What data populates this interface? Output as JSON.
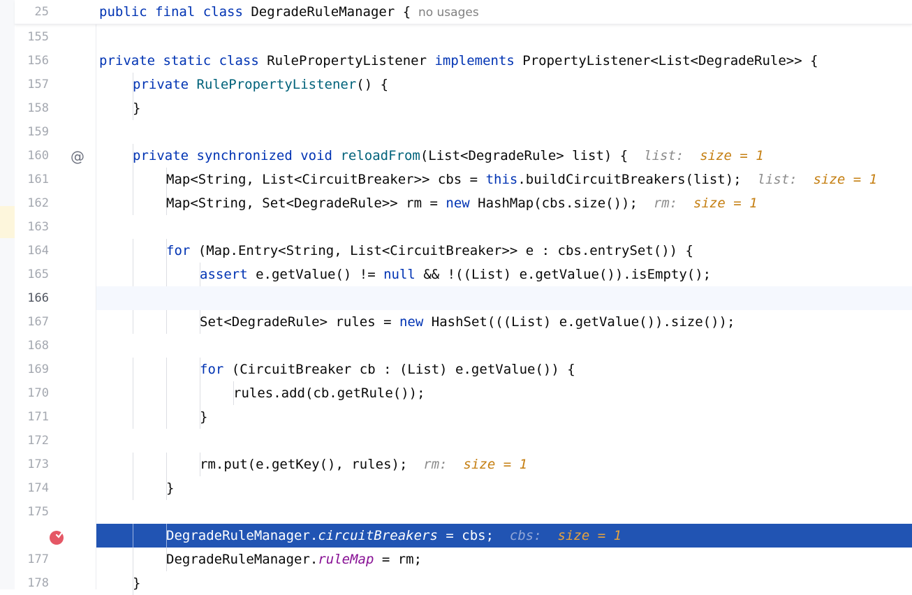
{
  "editor": {
    "sticky_line": {
      "number": "25",
      "tokens": [
        {
          "t": "public ",
          "c": "kw"
        },
        {
          "t": "final ",
          "c": "kw"
        },
        {
          "t": "class ",
          "c": "kw"
        },
        {
          "t": "DegradeRuleManager {"
        }
      ],
      "usages_label": "no usages"
    },
    "lines": [
      {
        "number": "155",
        "indent": 0,
        "tokens": []
      },
      {
        "number": "156",
        "indent": 1,
        "tokens": [
          {
            "t": "private ",
            "c": "kw"
          },
          {
            "t": "static ",
            "c": "kw"
          },
          {
            "t": "class ",
            "c": "kw"
          },
          {
            "t": "RulePropertyListener "
          },
          {
            "t": "implements ",
            "c": "kw"
          },
          {
            "t": "PropertyListener<List<DegradeRule>> {"
          }
        ]
      },
      {
        "number": "157",
        "indent": 2,
        "tokens": [
          {
            "t": "private ",
            "c": "kw"
          },
          {
            "t": "RulePropertyListener",
            "c": "fn"
          },
          {
            "t": "() {"
          }
        ]
      },
      {
        "number": "158",
        "indent": 2,
        "tokens": [
          {
            "t": "}"
          }
        ]
      },
      {
        "number": "159",
        "indent": 0,
        "tokens": []
      },
      {
        "number": "160",
        "indent": 2,
        "tokens": [
          {
            "t": "private ",
            "c": "kw"
          },
          {
            "t": "synchronized ",
            "c": "kw"
          },
          {
            "t": "void ",
            "c": "kw"
          },
          {
            "t": "reloadFrom",
            "c": "fn"
          },
          {
            "t": "(List<DegradeRule> list) {  "
          },
          {
            "t": "list:  ",
            "c": "hint"
          },
          {
            "t": "size = 1",
            "c": "val"
          }
        ],
        "marker": "at-sign"
      },
      {
        "number": "161",
        "indent": 3,
        "tokens": [
          {
            "t": "Map<String, List<CircuitBreaker>> cbs = "
          },
          {
            "t": "this",
            "c": "kw"
          },
          {
            "t": ".buildCircuitBreakers(list);  "
          },
          {
            "t": "list:  ",
            "c": "hint"
          },
          {
            "t": "size = 1",
            "c": "val"
          }
        ]
      },
      {
        "number": "162",
        "indent": 3,
        "tokens": [
          {
            "t": "Map<String, Set<DegradeRule>> rm = "
          },
          {
            "t": "new ",
            "c": "kw"
          },
          {
            "t": "HashMap(cbs.size());  "
          },
          {
            "t": "rm:  ",
            "c": "hint"
          },
          {
            "t": "size = 1",
            "c": "val"
          }
        ]
      },
      {
        "number": "163",
        "indent": 0,
        "tokens": []
      },
      {
        "number": "164",
        "indent": 3,
        "tokens": [
          {
            "t": "for ",
            "c": "kw"
          },
          {
            "t": "(Map.Entry<String, List<CircuitBreaker>> e : cbs.entrySet()) {"
          }
        ]
      },
      {
        "number": "165",
        "indent": 4,
        "tokens": [
          {
            "t": "assert ",
            "c": "kw"
          },
          {
            "t": "e.getValue() != "
          },
          {
            "t": "null ",
            "c": "kw"
          },
          {
            "t": "&& !((List) e.getValue()).isEmpty();"
          }
        ]
      },
      {
        "number": "166",
        "indent": 0,
        "tokens": [],
        "current": true
      },
      {
        "number": "167",
        "indent": 4,
        "tokens": [
          {
            "t": "Set<DegradeRule> rules = "
          },
          {
            "t": "new ",
            "c": "kw"
          },
          {
            "t": "HashSet(((List) e.getValue()).size());"
          }
        ]
      },
      {
        "number": "168",
        "indent": 0,
        "tokens": []
      },
      {
        "number": "169",
        "indent": 4,
        "tokens": [
          {
            "t": "for ",
            "c": "kw"
          },
          {
            "t": "(CircuitBreaker cb : (List) e.getValue()) {"
          }
        ]
      },
      {
        "number": "170",
        "indent": 5,
        "tokens": [
          {
            "t": "rules.add(cb.getRule());"
          }
        ]
      },
      {
        "number": "171",
        "indent": 4,
        "tokens": [
          {
            "t": "}"
          }
        ]
      },
      {
        "number": "172",
        "indent": 0,
        "tokens": []
      },
      {
        "number": "173",
        "indent": 4,
        "tokens": [
          {
            "t": "rm.put(e.getKey(), rules);  "
          },
          {
            "t": "rm:  ",
            "c": "hint"
          },
          {
            "t": "size = 1",
            "c": "val"
          }
        ]
      },
      {
        "number": "174",
        "indent": 3,
        "tokens": [
          {
            "t": "}"
          }
        ]
      },
      {
        "number": "175",
        "indent": 0,
        "tokens": []
      },
      {
        "number": "",
        "indent": 3,
        "tokens": [
          {
            "t": "DegradeRuleManager."
          },
          {
            "t": "circuitBreakers",
            "c": "st"
          },
          {
            "t": " = cbs;  "
          },
          {
            "t": "cbs:  ",
            "c": "hint"
          },
          {
            "t": "size = 1",
            "c": "val"
          }
        ],
        "exec": true,
        "marker": "breakpoint"
      },
      {
        "number": "177",
        "indent": 3,
        "tokens": [
          {
            "t": "DegradeRuleManager."
          },
          {
            "t": "ruleMap",
            "c": "st"
          },
          {
            "t": " = rm;"
          }
        ]
      },
      {
        "number": "178",
        "indent": 2,
        "tokens": [
          {
            "t": "}"
          }
        ]
      }
    ],
    "colors": {
      "keyword": "#0033b3",
      "method": "#00627a",
      "static_field": "#871094",
      "inline_hint": "#8c8c8c",
      "inline_value": "#c57f12",
      "execution_line": "#2154b3",
      "breakpoint": "#e55765"
    }
  }
}
